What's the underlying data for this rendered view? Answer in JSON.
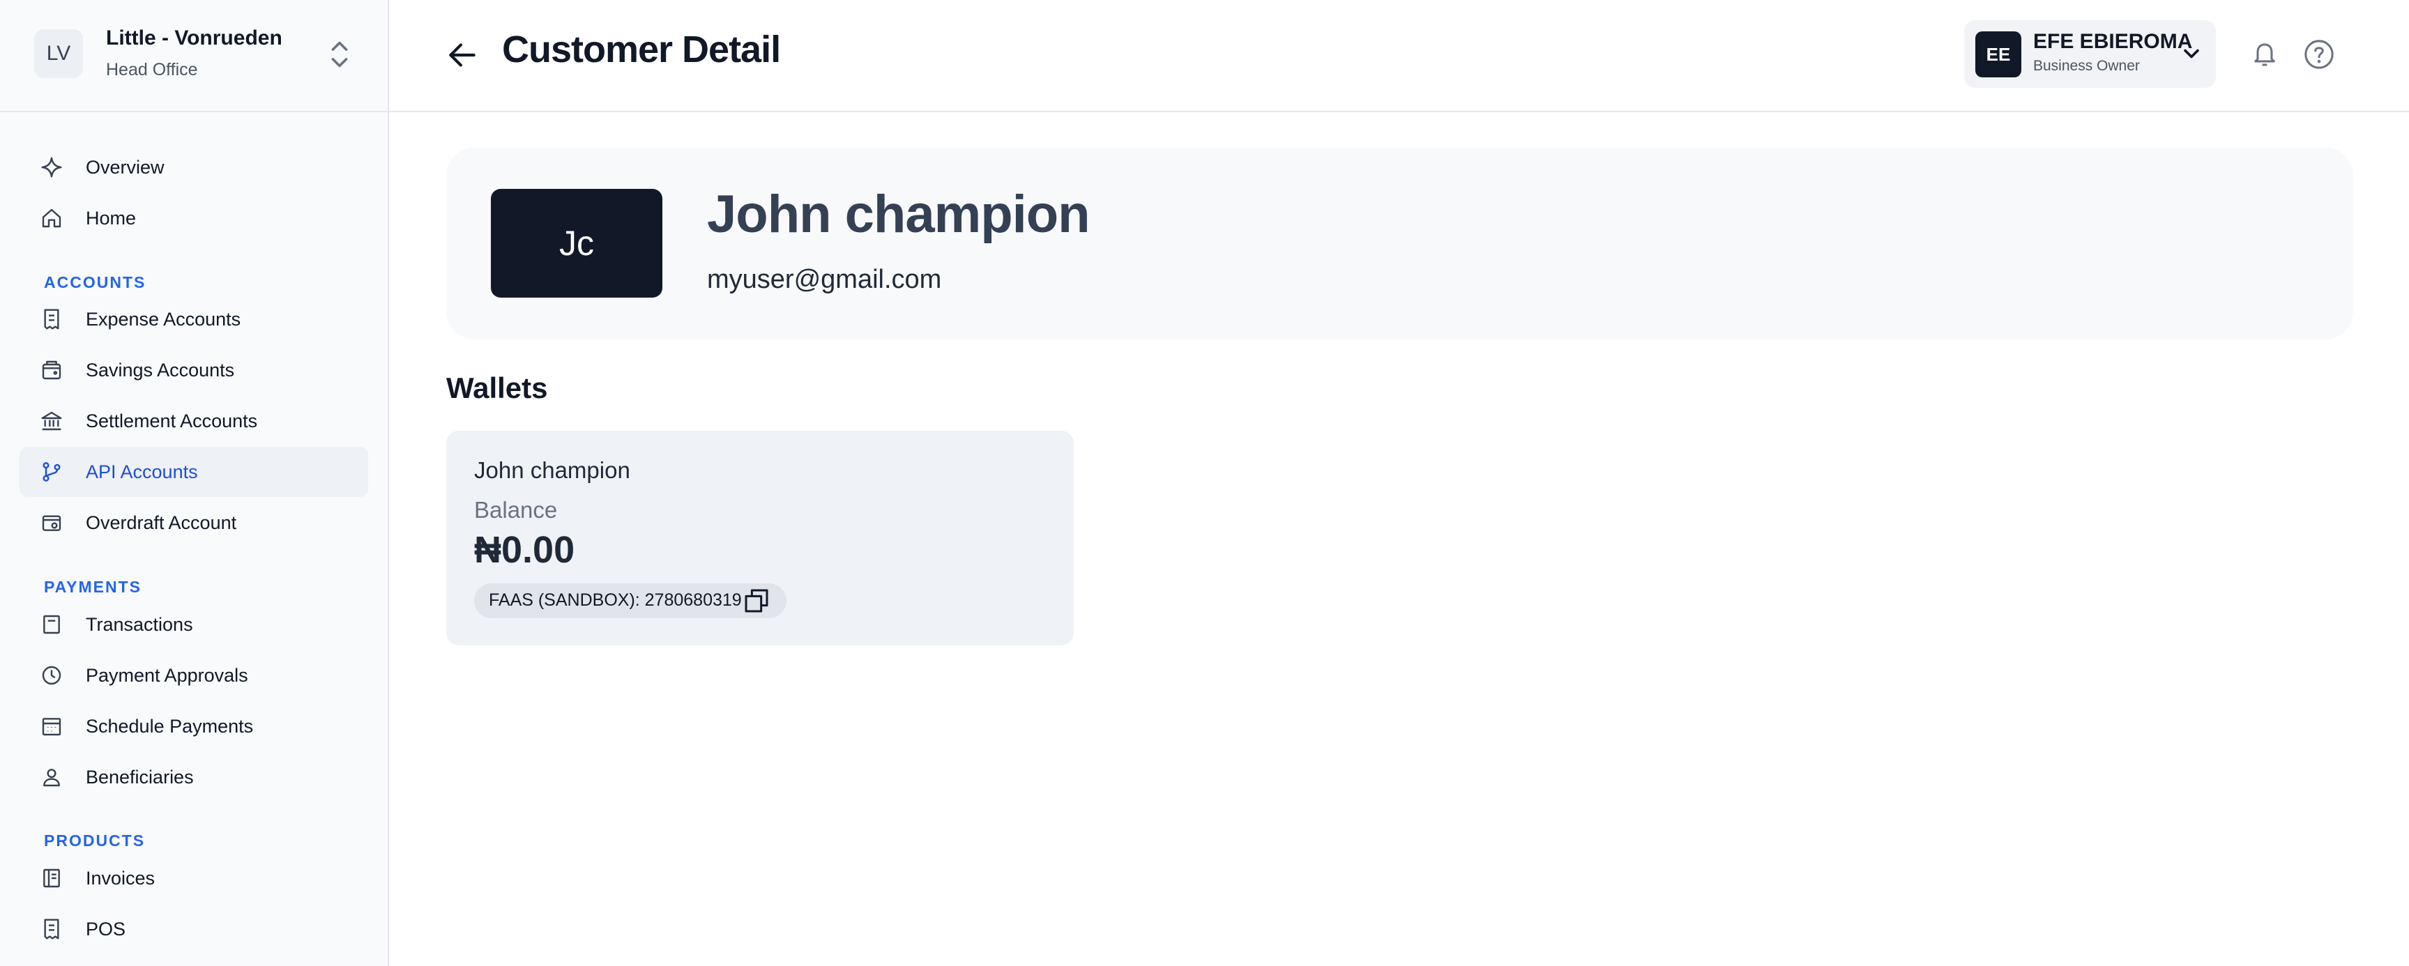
{
  "org": {
    "initials": "LV",
    "name": "Little - Vonrueden",
    "branch": "Head Office"
  },
  "header": {
    "title": "Customer Detail"
  },
  "user": {
    "initials": "EE",
    "name": "EFE EBIEROMA",
    "role": "Business Owner"
  },
  "nav": {
    "overview": "Overview",
    "home": "Home",
    "accounts_heading": "ACCOUNTS",
    "expense": "Expense Accounts",
    "savings": "Savings Accounts",
    "settlement": "Settlement Accounts",
    "api": "API Accounts",
    "overdraft": "Overdraft Account",
    "payments_heading": "PAYMENTS",
    "transactions": "Transactions",
    "approvals": "Payment Approvals",
    "schedule": "Schedule Payments",
    "beneficiaries": "Beneficiaries",
    "products_heading": "PRODUCTS",
    "invoices": "Invoices",
    "pos": "POS"
  },
  "customer": {
    "initials": "Jc",
    "name": "John champion",
    "email": "myuser@gmail.com"
  },
  "wallets": {
    "title": "Wallets",
    "items": [
      {
        "name": "John champion",
        "balance_label": "Balance",
        "balance": "₦0.00",
        "account": "FAAS (SANDBOX): 2780680319"
      }
    ]
  },
  "colors": {
    "accent": "#2563eb",
    "active_bg": "#eef1f6",
    "dark": "#111827"
  }
}
